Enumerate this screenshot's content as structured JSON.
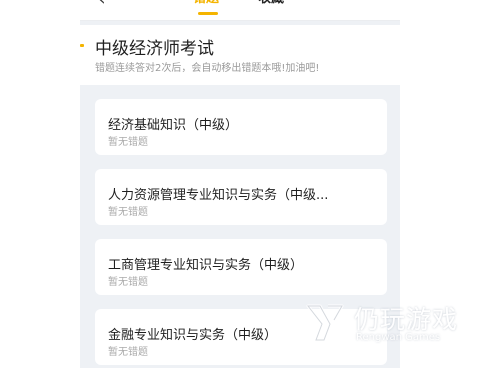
{
  "header": {
    "back_icon": "chevron-left-icon",
    "tabs": [
      {
        "label": "错题",
        "active": true
      },
      {
        "label": "收藏",
        "active": false
      }
    ],
    "accent_color": "#f4b400"
  },
  "exam": {
    "title": "中级经济师考试",
    "hint": "错题连续答对2次后，会自动移出错题本哦!加油吧!"
  },
  "subjects": [
    {
      "title": "经济基础知识（中级）",
      "status": "暂无错题"
    },
    {
      "title": "人力资源管理专业知识与实务（中级...",
      "status": "暂无错题"
    },
    {
      "title": "工商管理专业知识与实务（中级）",
      "status": "暂无错题"
    },
    {
      "title": "金融专业知识与实务（中级）",
      "status": "暂无错题"
    }
  ],
  "watermark": {
    "name": "仍玩游戏",
    "sub": "Rengwan Games"
  }
}
